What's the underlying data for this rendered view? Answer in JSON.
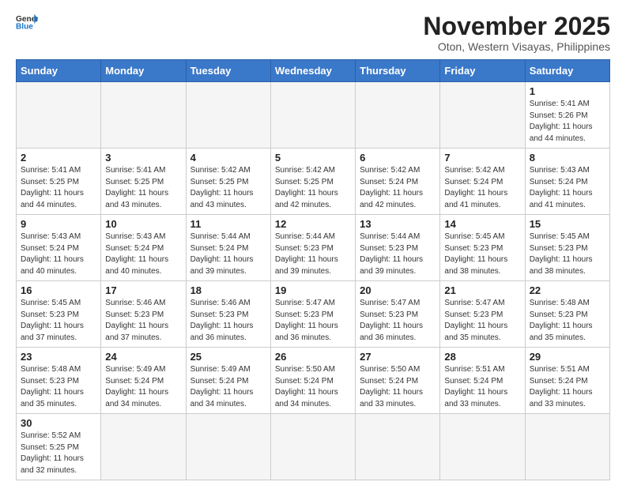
{
  "header": {
    "logo_general": "General",
    "logo_blue": "Blue",
    "month_title": "November 2025",
    "subtitle": "Oton, Western Visayas, Philippines"
  },
  "weekdays": [
    "Sunday",
    "Monday",
    "Tuesday",
    "Wednesday",
    "Thursday",
    "Friday",
    "Saturday"
  ],
  "weeks": [
    [
      {
        "day": "",
        "info": ""
      },
      {
        "day": "",
        "info": ""
      },
      {
        "day": "",
        "info": ""
      },
      {
        "day": "",
        "info": ""
      },
      {
        "day": "",
        "info": ""
      },
      {
        "day": "",
        "info": ""
      },
      {
        "day": "1",
        "info": "Sunrise: 5:41 AM\nSunset: 5:26 PM\nDaylight: 11 hours\nand 44 minutes."
      }
    ],
    [
      {
        "day": "2",
        "info": "Sunrise: 5:41 AM\nSunset: 5:25 PM\nDaylight: 11 hours\nand 44 minutes."
      },
      {
        "day": "3",
        "info": "Sunrise: 5:41 AM\nSunset: 5:25 PM\nDaylight: 11 hours\nand 43 minutes."
      },
      {
        "day": "4",
        "info": "Sunrise: 5:42 AM\nSunset: 5:25 PM\nDaylight: 11 hours\nand 43 minutes."
      },
      {
        "day": "5",
        "info": "Sunrise: 5:42 AM\nSunset: 5:25 PM\nDaylight: 11 hours\nand 42 minutes."
      },
      {
        "day": "6",
        "info": "Sunrise: 5:42 AM\nSunset: 5:24 PM\nDaylight: 11 hours\nand 42 minutes."
      },
      {
        "day": "7",
        "info": "Sunrise: 5:42 AM\nSunset: 5:24 PM\nDaylight: 11 hours\nand 41 minutes."
      },
      {
        "day": "8",
        "info": "Sunrise: 5:43 AM\nSunset: 5:24 PM\nDaylight: 11 hours\nand 41 minutes."
      }
    ],
    [
      {
        "day": "9",
        "info": "Sunrise: 5:43 AM\nSunset: 5:24 PM\nDaylight: 11 hours\nand 40 minutes."
      },
      {
        "day": "10",
        "info": "Sunrise: 5:43 AM\nSunset: 5:24 PM\nDaylight: 11 hours\nand 40 minutes."
      },
      {
        "day": "11",
        "info": "Sunrise: 5:44 AM\nSunset: 5:24 PM\nDaylight: 11 hours\nand 39 minutes."
      },
      {
        "day": "12",
        "info": "Sunrise: 5:44 AM\nSunset: 5:23 PM\nDaylight: 11 hours\nand 39 minutes."
      },
      {
        "day": "13",
        "info": "Sunrise: 5:44 AM\nSunset: 5:23 PM\nDaylight: 11 hours\nand 39 minutes."
      },
      {
        "day": "14",
        "info": "Sunrise: 5:45 AM\nSunset: 5:23 PM\nDaylight: 11 hours\nand 38 minutes."
      },
      {
        "day": "15",
        "info": "Sunrise: 5:45 AM\nSunset: 5:23 PM\nDaylight: 11 hours\nand 38 minutes."
      }
    ],
    [
      {
        "day": "16",
        "info": "Sunrise: 5:45 AM\nSunset: 5:23 PM\nDaylight: 11 hours\nand 37 minutes."
      },
      {
        "day": "17",
        "info": "Sunrise: 5:46 AM\nSunset: 5:23 PM\nDaylight: 11 hours\nand 37 minutes."
      },
      {
        "day": "18",
        "info": "Sunrise: 5:46 AM\nSunset: 5:23 PM\nDaylight: 11 hours\nand 36 minutes."
      },
      {
        "day": "19",
        "info": "Sunrise: 5:47 AM\nSunset: 5:23 PM\nDaylight: 11 hours\nand 36 minutes."
      },
      {
        "day": "20",
        "info": "Sunrise: 5:47 AM\nSunset: 5:23 PM\nDaylight: 11 hours\nand 36 minutes."
      },
      {
        "day": "21",
        "info": "Sunrise: 5:47 AM\nSunset: 5:23 PM\nDaylight: 11 hours\nand 35 minutes."
      },
      {
        "day": "22",
        "info": "Sunrise: 5:48 AM\nSunset: 5:23 PM\nDaylight: 11 hours\nand 35 minutes."
      }
    ],
    [
      {
        "day": "23",
        "info": "Sunrise: 5:48 AM\nSunset: 5:23 PM\nDaylight: 11 hours\nand 35 minutes."
      },
      {
        "day": "24",
        "info": "Sunrise: 5:49 AM\nSunset: 5:24 PM\nDaylight: 11 hours\nand 34 minutes."
      },
      {
        "day": "25",
        "info": "Sunrise: 5:49 AM\nSunset: 5:24 PM\nDaylight: 11 hours\nand 34 minutes."
      },
      {
        "day": "26",
        "info": "Sunrise: 5:50 AM\nSunset: 5:24 PM\nDaylight: 11 hours\nand 34 minutes."
      },
      {
        "day": "27",
        "info": "Sunrise: 5:50 AM\nSunset: 5:24 PM\nDaylight: 11 hours\nand 33 minutes."
      },
      {
        "day": "28",
        "info": "Sunrise: 5:51 AM\nSunset: 5:24 PM\nDaylight: 11 hours\nand 33 minutes."
      },
      {
        "day": "29",
        "info": "Sunrise: 5:51 AM\nSunset: 5:24 PM\nDaylight: 11 hours\nand 33 minutes."
      }
    ],
    [
      {
        "day": "30",
        "info": "Sunrise: 5:52 AM\nSunset: 5:25 PM\nDaylight: 11 hours\nand 32 minutes."
      },
      {
        "day": "",
        "info": ""
      },
      {
        "day": "",
        "info": ""
      },
      {
        "day": "",
        "info": ""
      },
      {
        "day": "",
        "info": ""
      },
      {
        "day": "",
        "info": ""
      },
      {
        "day": "",
        "info": ""
      }
    ]
  ]
}
